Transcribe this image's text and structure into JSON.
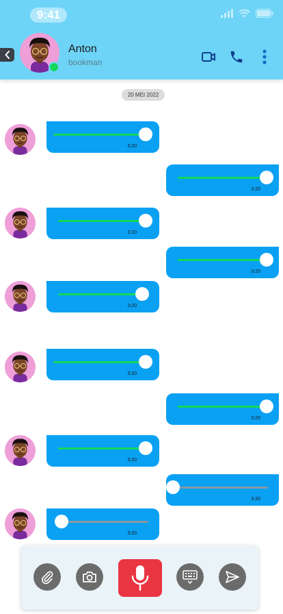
{
  "status_bar": {
    "time": "9:41"
  },
  "header": {
    "contact_name": "Anton",
    "contact_status": "bookman",
    "colors": {
      "background": "#6dd4f7",
      "icon": "#0e3f8c",
      "online": "#12d85a"
    }
  },
  "chat": {
    "date_label": "20 MEI 2022",
    "bubble_color": "#0aa1f3",
    "messages": [
      {
        "direction": "incoming",
        "duration": "3:20",
        "progress": 1.0
      },
      {
        "direction": "outgoing",
        "duration": "3:20",
        "progress": 1.0
      },
      {
        "direction": "incoming",
        "duration": "3:20",
        "progress": 1.0
      },
      {
        "direction": "outgoing",
        "duration": "3:20",
        "progress": 1.0
      },
      {
        "direction": "incoming",
        "duration": "3:20",
        "progress": 1.0
      },
      {
        "direction": "incoming",
        "duration": "3:20",
        "progress": 1.0
      },
      {
        "direction": "outgoing",
        "duration": "3:20",
        "progress": 1.0
      },
      {
        "direction": "incoming",
        "duration": "3:20",
        "progress": 1.0
      },
      {
        "direction": "outgoing",
        "duration": "3:20",
        "progress": 0.0
      },
      {
        "direction": "incoming",
        "duration": "3:20",
        "progress": 0.0
      }
    ]
  },
  "composer": {
    "buttons": [
      "paperclip-icon",
      "camera-icon",
      "microphone-icon",
      "keyboard-icon",
      "send-icon"
    ],
    "mic_color": "#ea3543"
  }
}
